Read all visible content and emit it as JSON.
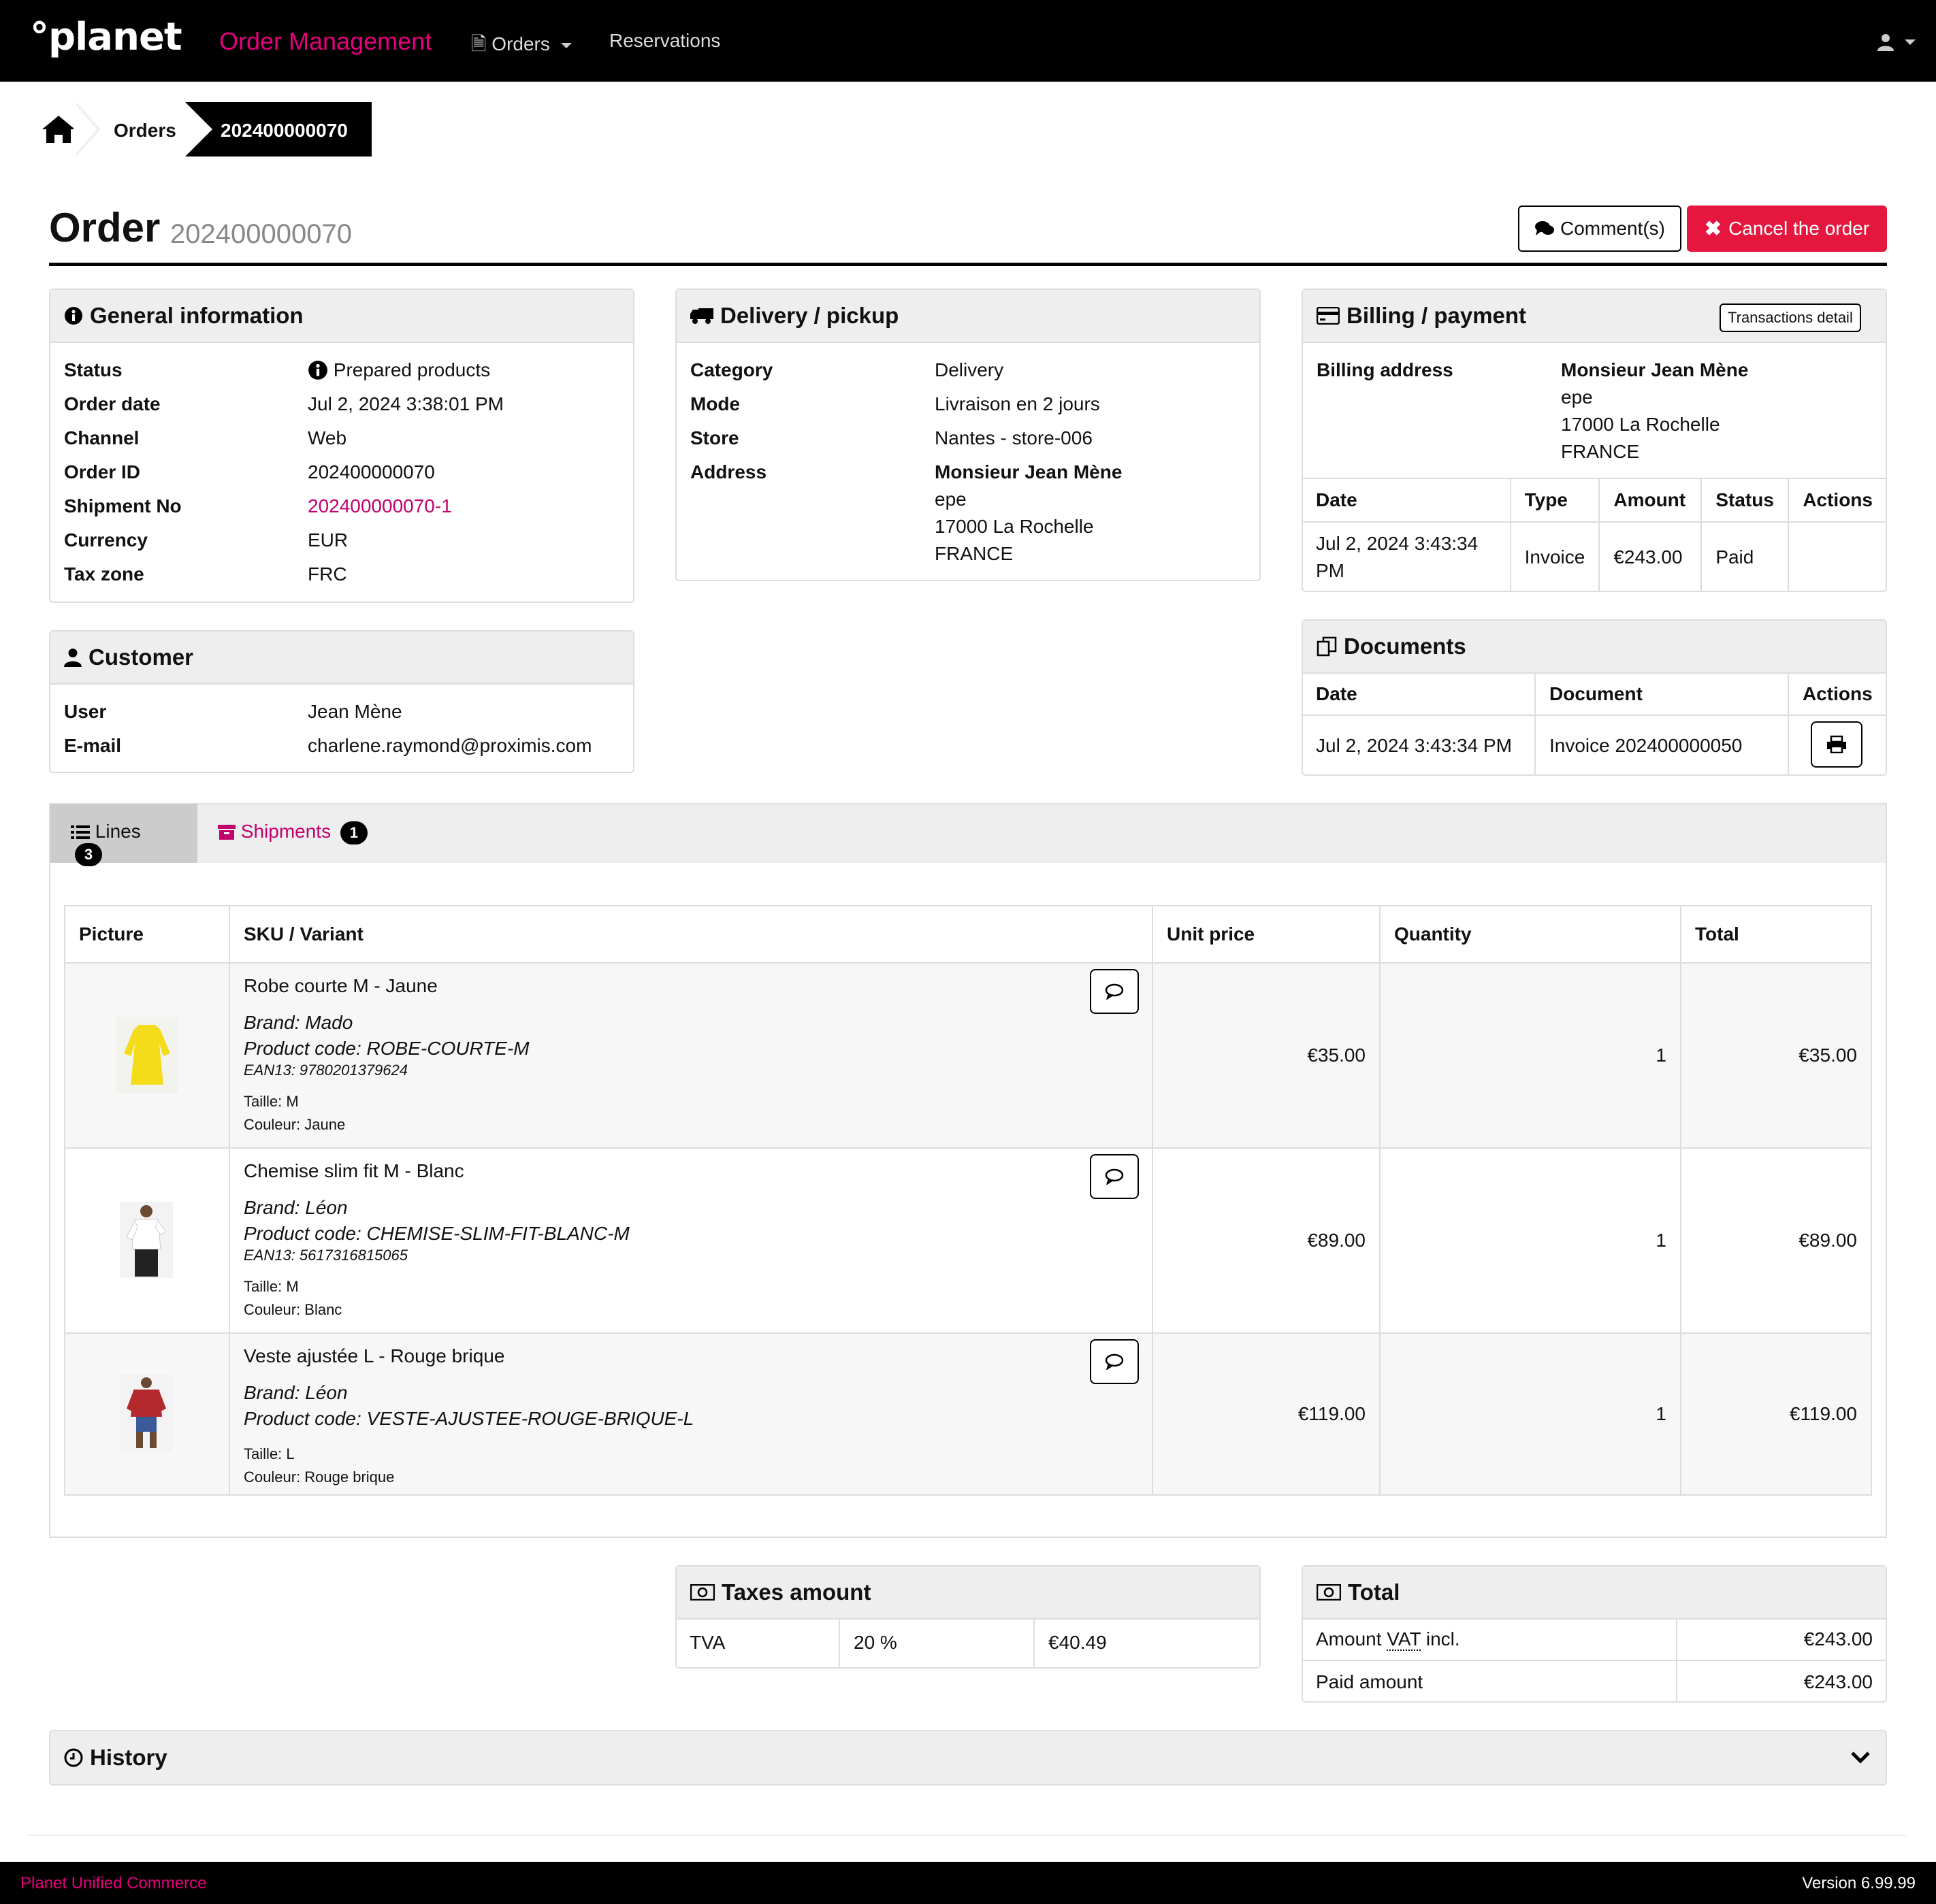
{
  "navbar": {
    "logo": "°planet",
    "app_name": "Order Management",
    "orders_menu": "Orders",
    "reservations": "Reservations"
  },
  "breadcrumb": {
    "orders": "Orders",
    "current": "202400000070"
  },
  "header": {
    "title": "Order",
    "order_id": "202400000070",
    "comments_btn": "Comment(s)",
    "cancel_btn": "Cancel the order"
  },
  "general": {
    "title": "General information",
    "rows": [
      {
        "k": "Status",
        "v": "Prepared products"
      },
      {
        "k": "Order date",
        "v": "Jul 2, 2024 3:38:01 PM"
      },
      {
        "k": "Channel",
        "v": "Web"
      },
      {
        "k": "Order ID",
        "v": "202400000070"
      },
      {
        "k": "Shipment No",
        "v": "202400000070-1"
      },
      {
        "k": "Currency",
        "v": "EUR"
      },
      {
        "k": "Tax zone",
        "v": "FRC"
      }
    ]
  },
  "delivery": {
    "title": "Delivery / pickup",
    "rows": [
      {
        "k": "Category",
        "v": "Delivery"
      },
      {
        "k": "Mode",
        "v": "Livraison en 2 jours"
      },
      {
        "k": "Store",
        "v": "Nantes - store-006"
      },
      {
        "k": "Address",
        "v": "Monsieur Jean Mène"
      }
    ],
    "address_lines": [
      "epe",
      "17000 La Rochelle",
      "FRANCE"
    ]
  },
  "billing": {
    "title": "Billing / payment",
    "transactions_btn": "Transactions detail",
    "address_label": "Billing address",
    "name": "Monsieur Jean Mène",
    "address_lines": [
      "epe",
      "17000 La Rochelle",
      "FRANCE"
    ],
    "headers": [
      "Date",
      "Type",
      "Amount",
      "Status",
      "Actions"
    ],
    "row": {
      "date1": "Jul 2, 2024 3:43:34",
      "date2": "PM",
      "type": "Invoice",
      "amount": "€243.00",
      "status": "Paid"
    }
  },
  "documents": {
    "title": "Documents",
    "headers": [
      "Date",
      "Document",
      "Actions"
    ],
    "row": {
      "date": "Jul 2, 2024 3:43:34 PM",
      "document": "Invoice 202400000050"
    }
  },
  "customer": {
    "title": "Customer",
    "rows": [
      {
        "k": "User",
        "v": "Jean Mène"
      },
      {
        "k": "E-mail",
        "v": "charlene.raymond@proximis.com"
      }
    ]
  },
  "tabs": {
    "lines": "Lines",
    "lines_count": "3",
    "shipments": "Shipments",
    "shipments_count": "1"
  },
  "lines": {
    "headers": [
      "Picture",
      "SKU / Variant",
      "Unit price",
      "Quantity",
      "Total"
    ],
    "items": [
      {
        "name": "Robe courte M - Jaune",
        "brand": "Brand: Mado",
        "code": "Product code: ROBE-COURTE-M",
        "ean": "EAN13: 9780201379624",
        "size": "Taille: M",
        "color": "Couleur: Jaune",
        "unit": "€35.00",
        "qty": "1",
        "total": "€35.00"
      },
      {
        "name": "Chemise slim fit M - Blanc",
        "brand": "Brand: Léon",
        "code": "Product code: CHEMISE-SLIM-FIT-BLANC-M",
        "ean": "EAN13: 5617316815065",
        "size": "Taille: M",
        "color": "Couleur: Blanc",
        "unit": "€89.00",
        "qty": "1",
        "total": "€89.00"
      },
      {
        "name": "Veste ajustée L - Rouge brique",
        "brand": "Brand: Léon",
        "code": "Product code: VESTE-AJUSTEE-ROUGE-BRIQUE-L",
        "size": "Taille: L",
        "color": "Couleur: Rouge brique",
        "unit": "€119.00",
        "qty": "1",
        "total": "€119.00"
      }
    ]
  },
  "taxes": {
    "title": "Taxes amount",
    "name": "TVA",
    "rate": "20 %",
    "amount": "€40.49"
  },
  "total": {
    "title": "Total",
    "vat_label_pre": "Amount ",
    "vat_abbr": "VAT",
    "vat_label_post": " incl.",
    "vat_amount": "€243.00",
    "paid_label": "Paid amount",
    "paid_amount": "€243.00"
  },
  "history": {
    "title": "History"
  },
  "footer": {
    "left": "Planet Unified Commerce",
    "right": "Version 6.99.99"
  },
  "colors": {
    "brand": "#e6007e",
    "danger": "#e5173f",
    "nav_bg": "#000000"
  }
}
